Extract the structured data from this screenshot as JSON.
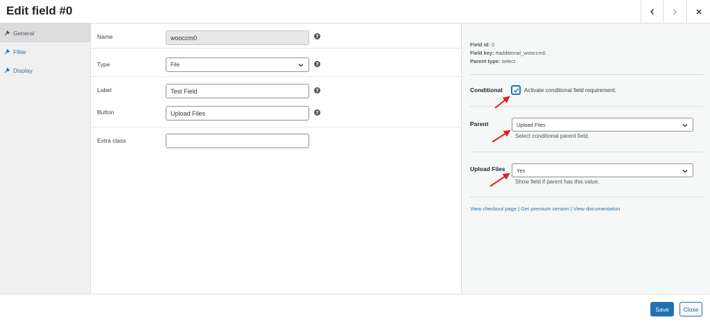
{
  "header": {
    "title": "Edit field #0"
  },
  "sidebar": {
    "tabs": [
      {
        "label": "General",
        "active": true
      },
      {
        "label": "Filter",
        "active": false
      },
      {
        "label": "Display",
        "active": false
      }
    ]
  },
  "main": {
    "name": {
      "label": "Name",
      "value": "wooccm0"
    },
    "type": {
      "label": "Type",
      "value": "File"
    },
    "label_field": {
      "label": "Label",
      "value": "Test Field"
    },
    "button": {
      "label": "Button",
      "value": "Upload Files"
    },
    "extra_class": {
      "label": "Extra class",
      "value": ""
    },
    "help_glyph": "?"
  },
  "panel": {
    "field_id": {
      "key": "Field id:",
      "value": "0"
    },
    "field_key": {
      "key": "Field key:",
      "value": "#additional_wooccm0"
    },
    "parent_type": {
      "key": "Parent type:",
      "value": "select"
    },
    "conditional": {
      "label": "Conditional",
      "checked": true,
      "text": "Activate conditional field requirement."
    },
    "parent": {
      "label": "Parent",
      "value": "Upload Files",
      "description": "Select conditional parent field."
    },
    "upload_files": {
      "label": "Upload Files",
      "value": "Yes",
      "description": "Show field if parent has this value."
    },
    "links": {
      "checkout": "View checkout page",
      "premium": "Get premium version",
      "docs": "View documentation",
      "separator": "|"
    }
  },
  "footer": {
    "save_label": "Save",
    "close_label": "Close"
  },
  "colors": {
    "accent": "#2271b1",
    "annotation_arrow": "#e02020"
  },
  "icons": {
    "tab": "wrench-icon",
    "prev": "chevron-left-icon",
    "next": "chevron-right-icon",
    "close": "close-icon",
    "select": "chevron-down-icon",
    "help": "help-icon",
    "check": "checkmark-icon"
  }
}
